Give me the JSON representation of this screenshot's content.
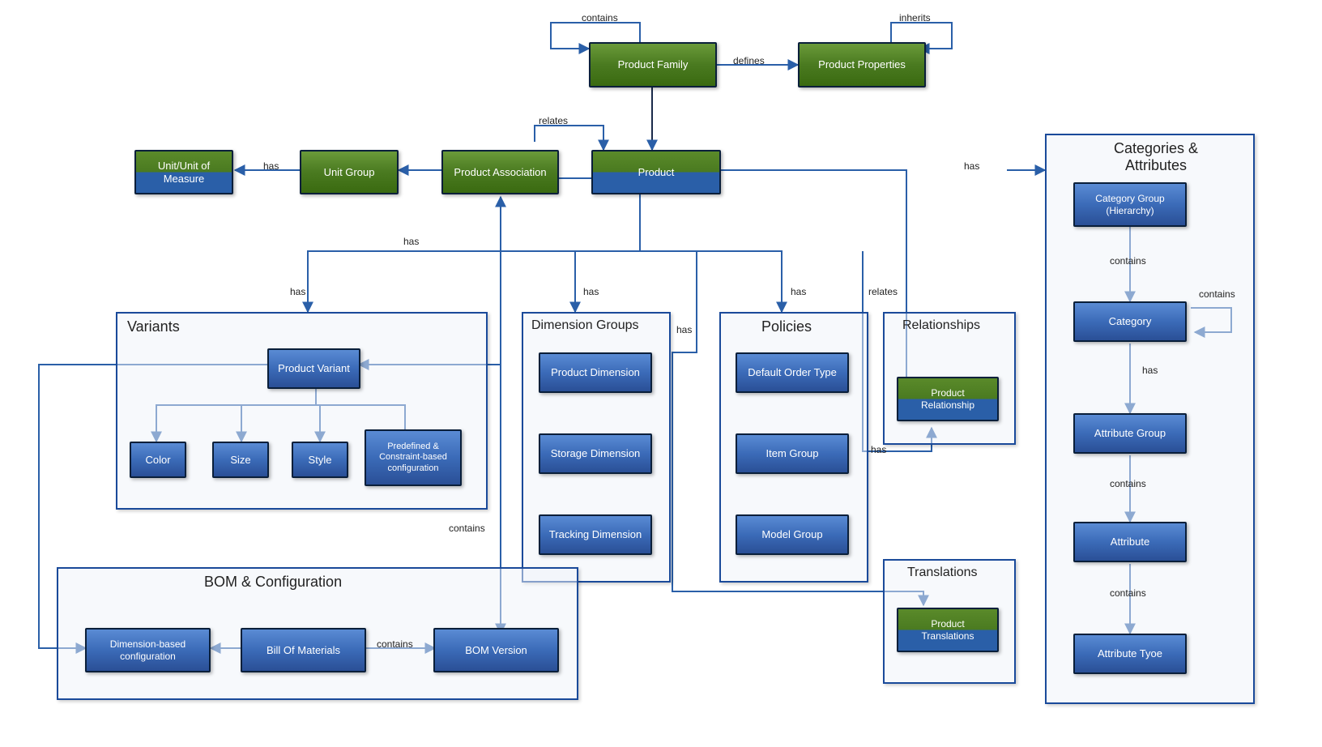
{
  "nodes": {
    "product_family": "Product Family",
    "product_properties": "Product Properties",
    "unit_uom": "Unit/Unit of Measure",
    "unit_group": "Unit Group",
    "product_association": "Product Association",
    "product": "Product",
    "product_variant": "Product Variant",
    "color": "Color",
    "size": "Size",
    "style": "Style",
    "predefined": "Predefined & Constraint-based configuration",
    "product_dimension": "Product Dimension",
    "storage_dimension": "Storage Dimension",
    "tracking_dimension": "Tracking Dimension",
    "default_order_type": "Default Order Type",
    "item_group": "Item Group",
    "model_group": "Model Group",
    "product_relationship_top": "Product",
    "product_relationship_bot": "Relationship",
    "dimension_based_config": "Dimension-based configuration",
    "bill_of_materials": "Bill Of Materials",
    "bom_version": "BOM Version",
    "product_translations_top": "Product",
    "product_translations_bot": "Translations",
    "category_group": "Category Group (Hierarchy)",
    "category": "Category",
    "attribute_group": "Attribute Group",
    "attribute": "Attribute",
    "attribute_type": "Attribute Tyoe"
  },
  "groups": {
    "variants": "Variants",
    "dimension_groups": "Dimension Groups",
    "policies": "Policies",
    "relationships": "Relationships",
    "bom_config": "BOM & Configuration",
    "translations": "Translations",
    "categories": "Categories & Attributes"
  },
  "edges": {
    "contains": "contains",
    "inherits": "inherits",
    "defines": "defines",
    "relates": "relates",
    "has": "has"
  }
}
